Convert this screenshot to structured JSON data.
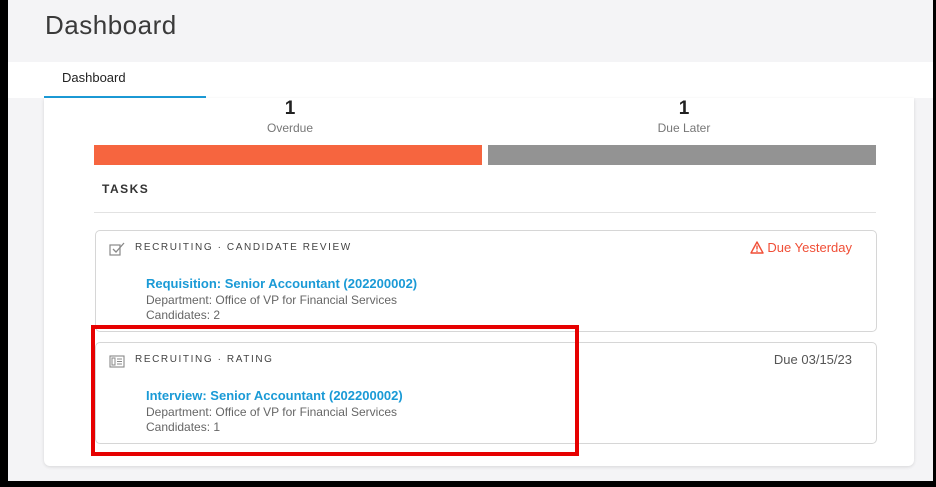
{
  "page": {
    "title": "Dashboard"
  },
  "tabs": [
    {
      "label": "Dashboard",
      "active": true
    }
  ],
  "summary": {
    "overdue": {
      "count": "1",
      "label": "Overdue",
      "color": "#f6653f"
    },
    "due_later": {
      "count": "1",
      "label": "Due Later",
      "color": "#939393"
    }
  },
  "tasks_heading": "TASKS",
  "tasks": [
    {
      "icon": "checkbox-icon",
      "category": "RECRUITING · CANDIDATE REVIEW",
      "due": "Due Yesterday",
      "due_status": "overdue",
      "title": "Requisition: Senior Accountant (202200002)",
      "department": "Department: Office of VP for Financial Services",
      "candidates": "Candidates: 2"
    },
    {
      "icon": "rating-icon",
      "category": "RECRUITING · RATING",
      "due": "Due 03/15/23",
      "due_status": "upcoming",
      "title": "Interview: Senior Accountant (202200002)",
      "department": "Department: Office of VP for Financial Services",
      "candidates": "Candidates: 1"
    }
  ],
  "colors": {
    "accent": "#1c9bd7",
    "link": "#1a9ad6",
    "warning": "#f04e36",
    "highlight": "#e60000"
  }
}
